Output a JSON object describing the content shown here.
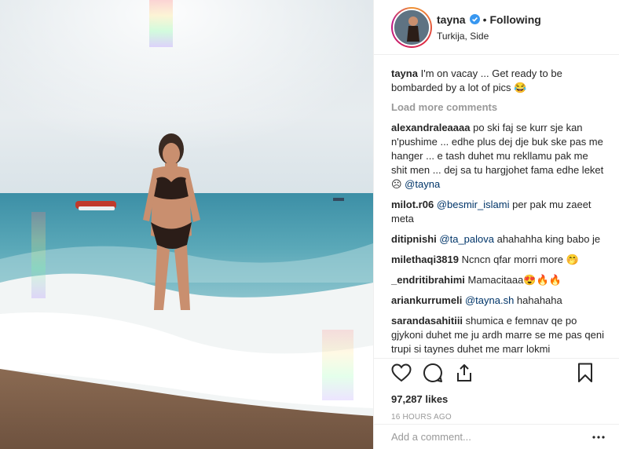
{
  "post": {
    "username": "tayna",
    "follow_label": "Following",
    "dot": "•",
    "location": "Turkija, Side"
  },
  "caption": {
    "author": "tayna",
    "text": "I'm on vacay ... Get ready to be bombarded by a lot of pics 😂"
  },
  "load_more": "Load more comments",
  "comments": [
    {
      "author": "alexandraleaaaa",
      "text": "po ski faj se kurr sje kan n'pushime ... edhe plus dej dje buk ske pas me hanger ... e tash duhet mu rekllamu pak me shit men ... dej sa tu hargjohet fama edhe leket ☹ ",
      "mention": "@tayna",
      "after": ""
    },
    {
      "author": "milot.r06",
      "text": "",
      "mention": "@besmir_islami",
      "after": " per pak mu zaeet meta"
    },
    {
      "author": "ditipnishi",
      "text": "",
      "mention": "@ta_palova",
      "after": " ahahahha king babo je"
    },
    {
      "author": "milethaqi3819",
      "text": "Ncncn qfar morri more 🤭",
      "mention": "",
      "after": ""
    },
    {
      "author": "_endritibrahimi",
      "text": "Mamacitaaa😍🔥🔥",
      "mention": "",
      "after": ""
    },
    {
      "author": "ariankurrumeli",
      "text": "",
      "mention": "@tayna.sh",
      "after": " hahahaha"
    },
    {
      "author": "sarandasahitiii",
      "text": "shumica e femnav qe po gjykoni duhet me ju ardh marre se me pas qeni trupi si taynes duhet me marr lokmi",
      "mention": "",
      "after": ""
    }
  ],
  "likes": "97,287 likes",
  "time": "16 HOURS AGO",
  "add_comment": {
    "placeholder": "Add a comment..."
  },
  "icons": {
    "like": "heart-icon",
    "comment": "comment-icon",
    "share": "share-icon",
    "save": "bookmark-icon",
    "verified": "verified-badge-icon",
    "more": "more-options-icon"
  },
  "colors": {
    "text": "#262626",
    "muted": "#999999",
    "mention": "#003569",
    "verified": "#3897f0",
    "border": "#efefef"
  }
}
